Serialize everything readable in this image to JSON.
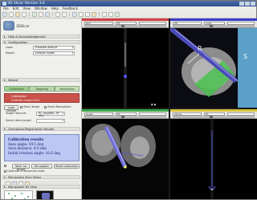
{
  "window": {
    "title": "3D Slicer Version 3.6"
  },
  "menu": [
    "File",
    "Edit",
    "View",
    "Window",
    "Help",
    "Feedback"
  ],
  "left_panel": {
    "logo_text": "3DSlicer",
    "sections": [
      {
        "label": "Help & Acknowledgement",
        "open": false
      },
      {
        "label": "Configuration",
        "open": true
      },
      {
        "label": "Wizard",
        "open": true
      },
      {
        "label": "Orientation/Registration Results",
        "open": true
      },
      {
        "label": "Manipulate Slice Views",
        "open": true
      },
      {
        "label": "Manipulate 3D View",
        "open": true
      }
    ],
    "config_rows": [
      {
        "label": "Load:",
        "value": "Prostate default"
      },
      {
        "label": "Model:",
        "value": "Default model"
      }
    ],
    "workflow_tabs": [
      "Calibration",
      "Targeting",
      "Verification"
    ],
    "status": {
      "label": "Calibration",
      "sub": "Calibrate images here"
    },
    "buttons": {
      "load": "Load volume",
      "add": "Add target",
      "remove": "Remove",
      "note": "Note: no target",
      "reg": "Re-register",
      "redo": "Reset calibration"
    },
    "checks": [
      "Show Target",
      "Show Worksphere"
    ],
    "rows2": [
      {
        "label": "Target Volume:",
        "value": "RL (sagittal, AP etc)"
      },
      {
        "label": "Select data target:",
        "value": ""
      }
    ],
    "info": {
      "heading": "Calibration results",
      "lines": [
        "Axes angle: 59.5 deg",
        "Axes distance: 4.0 mm",
        "Initial rotation angle: 16.6 deg"
      ]
    },
    "bottom_check": "Calibrate in advanced mode"
  },
  "views": [
    {
      "id": "red",
      "strip_color": "#d24040",
      "ctl1": "Red",
      "ctl2": "Fit"
    },
    {
      "id": "3d",
      "strip_color": "#3c3cc8",
      "ctl1": "3D",
      "ctl2": "View"
    },
    {
      "id": "green",
      "strip_color": "#3aa84a",
      "ctl1": "Green",
      "ctl2": "Fit"
    },
    {
      "id": "yellow",
      "strip_color": "#d8c23a",
      "ctl1": "Yellow",
      "ctl2": "Fit"
    }
  ],
  "three_d": {
    "orient_label": "R",
    "side_label": "S"
  }
}
